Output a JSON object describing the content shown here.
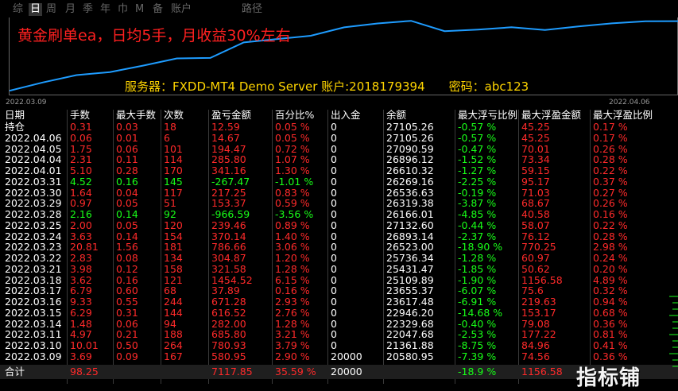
{
  "tabs": [
    "综",
    "日",
    "周",
    "月",
    "季",
    "年",
    "巾",
    "M",
    "备",
    "账户",
    "路径"
  ],
  "active_tab": 1,
  "chart": {
    "headline": "黄金刷单ea，日均5手，月收益30%左右",
    "server_label": "服务器：FXDD-MT4 Demo Server 账户:2018179394",
    "password_label": "密码：abc123",
    "start_date": "2022.03.09",
    "end_date": "2022.04.06",
    "line_color": "#1e9cff"
  },
  "chart_data": {
    "type": "line",
    "x": [
      "2022.03.09",
      "2022.03.10",
      "2022.03.11",
      "2022.03.14",
      "2022.03.15",
      "2022.03.16",
      "2022.03.17",
      "2022.03.18",
      "2022.03.21",
      "2022.03.22",
      "2022.03.23",
      "2022.03.24",
      "2022.03.25",
      "2022.03.28",
      "2022.03.29",
      "2022.03.30",
      "2022.03.31",
      "2022.04.01",
      "2022.04.04",
      "2022.04.05",
      "2022.04.06"
    ],
    "series": [
      {
        "values": [
          20580.95,
          21361.88,
          22047.68,
          22329.68,
          22946.2,
          23617.48,
          23655.37,
          25109.89,
          25431.47,
          25736.34,
          26523.0,
          26893.14,
          27132.6,
          26166.01,
          26319.38,
          26536.63,
          26269.16,
          26610.32,
          26896.12,
          27090.59,
          27105.26
        ]
      }
    ],
    "xlabel": "",
    "ylabel": ""
  },
  "table": {
    "headers": [
      "日期",
      "手数",
      "最大手数",
      "次数",
      "盈亏金额",
      "百分比%",
      "出入金",
      "余额",
      "最大浮亏比例",
      "最大浮盈金额",
      "最大浮盈比例"
    ],
    "rows": [
      {
        "c": [
          "持仓",
          "0.31",
          "0.03",
          "18",
          "12.59",
          "0.05 %",
          "0",
          "27105.26",
          "-0.57 %",
          "45.25",
          "0.17 %"
        ],
        "color": "red"
      },
      {
        "c": [
          "2022.04.06",
          "0.06",
          "0.01",
          "6",
          "14.67",
          "0.05 %",
          "0",
          "27105.26",
          "-0.57 %",
          "45.25",
          "0.17 %"
        ],
        "color": "red"
      },
      {
        "c": [
          "2022.04.05",
          "1.75",
          "0.06",
          "101",
          "194.47",
          "0.72 %",
          "0",
          "27090.59",
          "-0.47 %",
          "70.01",
          "0.26 %"
        ],
        "color": "red"
      },
      {
        "c": [
          "2022.04.04",
          "2.31",
          "0.11",
          "114",
          "285.80",
          "1.07 %",
          "0",
          "26896.12",
          "-1.52 %",
          "73.34",
          "0.28 %"
        ],
        "color": "red"
      },
      {
        "c": [
          "2022.04.01",
          "5.10",
          "0.28",
          "170",
          "341.16",
          "1.30 %",
          "0",
          "26610.32",
          "-1.27 %",
          "59.15",
          "0.22 %"
        ],
        "color": "red"
      },
      {
        "c": [
          "2022.03.31",
          "4.52",
          "0.16",
          "145",
          "-267.47",
          "-1.01 %",
          "0",
          "26269.16",
          "-2.25 %",
          "95.17",
          "0.37 %"
        ],
        "color": "green"
      },
      {
        "c": [
          "2022.03.30",
          "1.64",
          "0.04",
          "117",
          "217.25",
          "0.83 %",
          "0",
          "26536.63",
          "-0.19 %",
          "71.03",
          "0.27 %"
        ],
        "color": "red"
      },
      {
        "c": [
          "2022.03.29",
          "0.97",
          "0.05",
          "51",
          "153.37",
          "0.59 %",
          "0",
          "26319.38",
          "-3.87 %",
          "68.67",
          "0.26 %"
        ],
        "color": "red"
      },
      {
        "c": [
          "2022.03.28",
          "2.16",
          "0.14",
          "92",
          "-966.59",
          "-3.56 %",
          "0",
          "26166.01",
          "-4.85 %",
          "40.58",
          "0.16 %"
        ],
        "color": "green"
      },
      {
        "c": [
          "2022.03.25",
          "2.00",
          "0.05",
          "120",
          "239.46",
          "0.89 %",
          "0",
          "27132.60",
          "-0.44 %",
          "58.07",
          "0.22 %"
        ],
        "color": "red"
      },
      {
        "c": [
          "2022.03.24",
          "3.63",
          "0.14",
          "154",
          "370.14",
          "1.40 %",
          "0",
          "26893.14",
          "-2.37 %",
          "76.12",
          "0.28 %"
        ],
        "color": "red"
      },
      {
        "c": [
          "2022.03.23",
          "20.81",
          "1.56",
          "181",
          "786.66",
          "3.06 %",
          "0",
          "26523.00",
          "-18.90 %",
          "770.25",
          "2.98 %"
        ],
        "color": "red"
      },
      {
        "c": [
          "2022.03.22",
          "2.83",
          "0.08",
          "134",
          "304.87",
          "1.20 %",
          "0",
          "25736.34",
          "-1.28 %",
          "60.97",
          "0.24 %"
        ],
        "color": "red"
      },
      {
        "c": [
          "2022.03.21",
          "3.98",
          "0.12",
          "158",
          "321.58",
          "1.28 %",
          "0",
          "25431.47",
          "-1.85 %",
          "50.62",
          "0.20 %"
        ],
        "color": "red"
      },
      {
        "c": [
          "2022.03.18",
          "3.62",
          "0.16",
          "121",
          "1454.52",
          "6.15 %",
          "0",
          "25109.89",
          "-1.90 %",
          "1156.58",
          "4.89 %"
        ],
        "color": "red"
      },
      {
        "c": [
          "2022.03.17",
          "6.79",
          "0.60",
          "68",
          "37.89",
          "0.16 %",
          "0",
          "23655.37",
          "-6.07 %",
          "75.6",
          "0.32 %"
        ],
        "color": "red"
      },
      {
        "c": [
          "2022.03.16",
          "9.33",
          "0.55",
          "244",
          "671.28",
          "2.93 %",
          "0",
          "23617.48",
          "-6.91 %",
          "219.63",
          "0.94 %"
        ],
        "color": "red"
      },
      {
        "c": [
          "2022.03.15",
          "6.29",
          "0.31",
          "144",
          "616.52",
          "2.76 %",
          "0",
          "22946.20",
          "-14.68 %",
          "153.17",
          "0.68 %"
        ],
        "color": "red"
      },
      {
        "c": [
          "2022.03.14",
          "1.48",
          "0.06",
          "94",
          "282.00",
          "1.28 %",
          "0",
          "22329.68",
          "-0.40 %",
          "79.08",
          "0.36 %"
        ],
        "color": "red"
      },
      {
        "c": [
          "2022.03.11",
          "4.97",
          "0.21",
          "188",
          "685.80",
          "3.21 %",
          "0",
          "22047.68",
          "-2.53 %",
          "177.22",
          "0.81 %"
        ],
        "color": "red"
      },
      {
        "c": [
          "2022.03.10",
          "10.01",
          "0.50",
          "264",
          "780.93",
          "3.79 %",
          "0",
          "21361.88",
          "-8.75 %",
          "84.96",
          "0.41 %"
        ],
        "color": "red"
      },
      {
        "c": [
          "2022.03.09",
          "3.69",
          "0.09",
          "167",
          "580.95",
          "2.90 %",
          "20000",
          "20580.95",
          "-7.39 %",
          "74.56",
          "0.36 %"
        ],
        "color": "red"
      }
    ],
    "total": [
      "合计",
      "98.25",
      "",
      "",
      "7117.85",
      "35.59 %",
      "20000",
      "",
      "-18.9 %",
      "1156.58",
      ""
    ]
  },
  "watermark": "指标铺"
}
